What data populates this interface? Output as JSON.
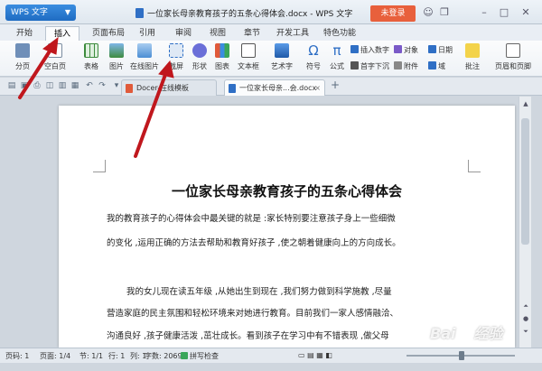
{
  "titlebar": {
    "app_button": "WPS 文字",
    "document_title": "一位家长母亲教育孩子的五条心得体会.docx - WPS 文字",
    "login_button": "未登录",
    "icons": [
      "skin-icon",
      "restore-icon",
      "minimize-icon",
      "maximize-icon",
      "close-icon"
    ]
  },
  "menu": {
    "tabs": [
      "开始",
      "插入",
      "页面布局",
      "引用",
      "审阅",
      "视图",
      "章节",
      "开发工具",
      "特色功能"
    ],
    "active": "插入"
  },
  "ribbon": {
    "page_break": "分页",
    "blank_page": "空白页",
    "table": "表格",
    "picture": "图片",
    "online_picture": "在线图片",
    "screenshot": "截屏",
    "shape": "形状",
    "chart": "图表",
    "text_box": "文本框",
    "art_text": "艺术字",
    "symbol": "符号",
    "formula": "公式",
    "insert_number": "插入数字",
    "object": "对象",
    "date": "日期",
    "first_letter_sink": "首字下沉",
    "attachment": "附件",
    "field": "域",
    "comment": "批注",
    "header_footer": "页眉和页脚"
  },
  "tabbar": {
    "tab_template": "Docer-在线模板",
    "tab_document": "一位家长母亲...会.docx",
    "add_tab": "+"
  },
  "document": {
    "heading": "一位家长母亲教育孩子的五条心得体会",
    "lines": [
      "我的教育孩子的心得体会中最关键的就是 :家长特别要注意孩子身上一些细微",
      "的变化 ,运用正确的方法去帮助和教育好孩子 ,使之朝着健康向上的方向成长。",
      "我的女儿现在读五年级 ,从她出生到现在 ,我们努力做到科学施教 ,尽量",
      "营造家庭的民主氛围和轻松环境来对她进行教育。目前我们一家人感情融洽、",
      "沟通良好 ,孩子健康活泼 ,茁壮成长。看到孩子在学习中有不错表现 ,做父母"
    ]
  },
  "statusbar": {
    "page": "页码: 1",
    "pages": "页面: 1/4",
    "section": "节: 1/1",
    "row": "行: 1",
    "column": "列: 1",
    "word_count": "字数: 2069",
    "spell_check": "拼写检查"
  },
  "watermark": "Baidu 经验",
  "colors": {
    "accent": "#1f6cc2",
    "login": "#e8603c",
    "arrow": "#c0171d"
  }
}
